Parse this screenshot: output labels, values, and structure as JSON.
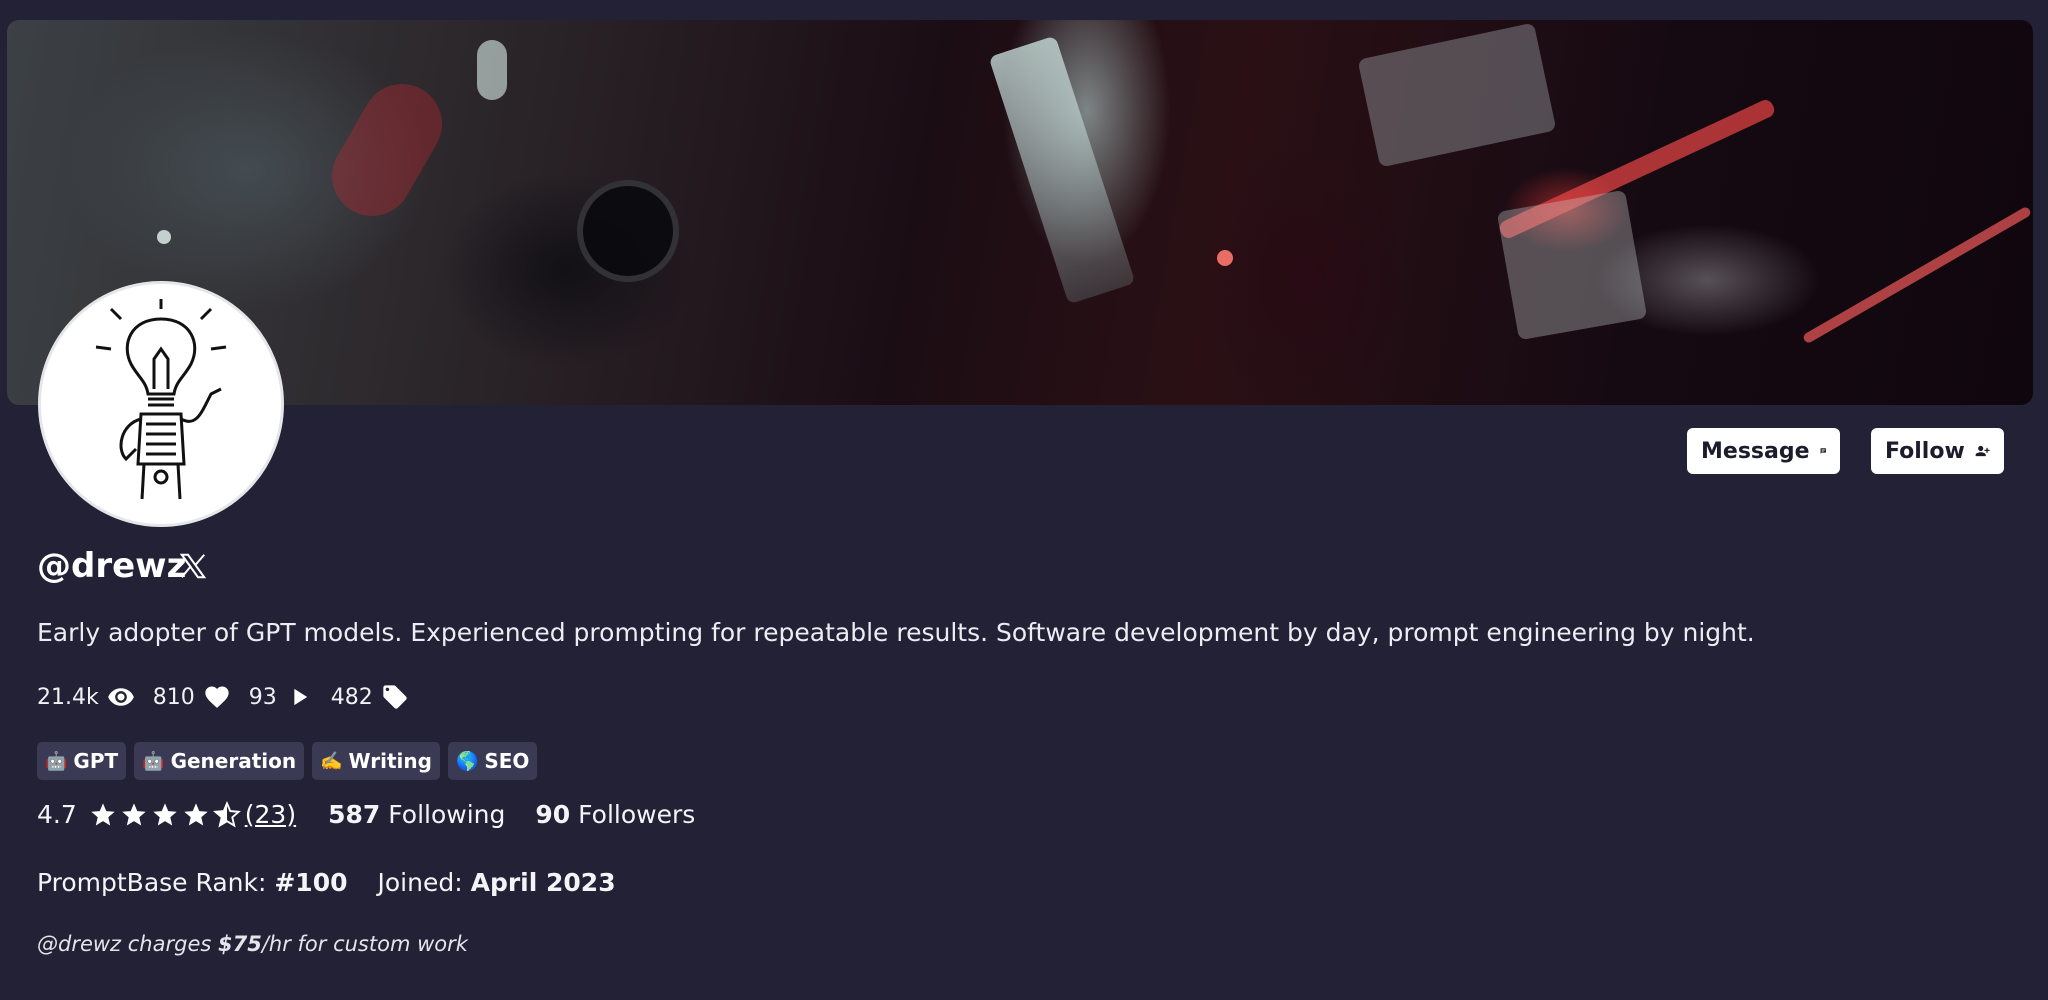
{
  "profile": {
    "username": "@drewz",
    "bio": "Early adopter of GPT models. Experienced prompting for repeatable results. Software development by day, prompt engineering by night."
  },
  "actions": {
    "message_label": "Message",
    "follow_label": "Follow"
  },
  "stats": {
    "views": "21.4k",
    "likes": "810",
    "plays": "93",
    "tags": "482"
  },
  "tags": [
    {
      "emoji": "🤖",
      "label": "GPT"
    },
    {
      "emoji": "🤖",
      "label": "Generation"
    },
    {
      "emoji": "✍️",
      "label": "Writing"
    },
    {
      "emoji": "🌎",
      "label": "SEO"
    }
  ],
  "rating": {
    "value": "4.7",
    "count": "(23)",
    "stars_out_of": 5
  },
  "following": {
    "count": "587",
    "label": "Following"
  },
  "followers": {
    "count": "90",
    "label": "Followers"
  },
  "rank": {
    "label": "PromptBase Rank:",
    "value": "#100"
  },
  "joined": {
    "label": "Joined:",
    "value": "April 2023"
  },
  "custom_work": {
    "prefix": "@drewz charges ",
    "price": "$75",
    "suffix": "/hr for custom work"
  },
  "icons": {
    "x_social": "x-logo-icon",
    "message": "chat-icon",
    "follow": "person-add-icon",
    "views": "eye-icon",
    "likes": "heart-icon",
    "plays": "play-icon",
    "tags": "tag-icon"
  }
}
